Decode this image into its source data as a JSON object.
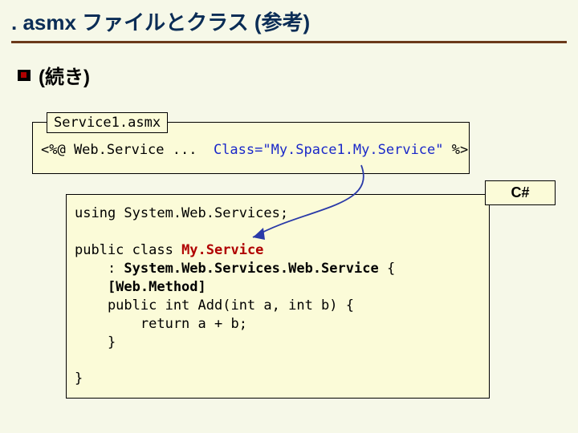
{
  "title": ". asmx ファイルとクラス (参考)",
  "bullet": "(続き)",
  "outer_tab": "Service1.asmx",
  "outer_code": {
    "prefix": "<%@ Web.Service ...  ",
    "class_attr": "Class=\"My.Space1.My.Service\"",
    "suffix": " %>"
  },
  "lang_badge": "C#",
  "code": {
    "l1": "using System.Web.Services;",
    "blank1": "",
    "l2a": "public class ",
    "l2b": "My.Service",
    "l3a": "    : ",
    "l3b": "System.Web.Services.Web.Service",
    "l3c": " {",
    "l4": "    [Web.Method]",
    "l5": "    public int Add(int a, int b) {",
    "l6": "        return a + b;",
    "l7": "    }",
    "blank2": "",
    "l8": "}"
  }
}
